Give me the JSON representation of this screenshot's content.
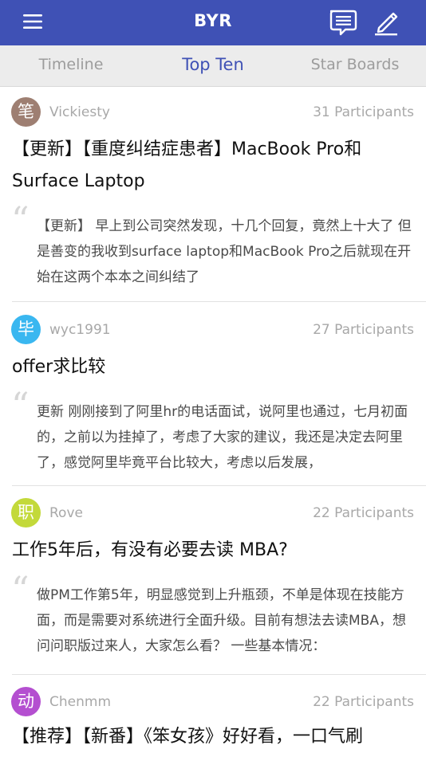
{
  "header": {
    "title": "BYR",
    "menu_icon": "hamburger-menu-icon",
    "messages_icon": "chat-bubble-icon",
    "compose_icon": "pencil-compose-icon",
    "color": "#3f51b5"
  },
  "tabs": [
    {
      "label": "Timeline",
      "active": false
    },
    {
      "label": "Top Ten",
      "active": true
    },
    {
      "label": "Star Boards",
      "active": false
    }
  ],
  "posts": [
    {
      "avatar_char": "笔",
      "avatar_color": "#9e7f72",
      "author": "Vickiesty",
      "participants": "31 Participants",
      "title": "【更新】【重度纠结症患者】MacBook Pro和Surface Laptop",
      "excerpt": "【更新】 早上到公司突然发现，十几个回复，竟然上十大了 但是善变的我收到surface laptop和MacBook Pro之后就现在开始在这两个本本之间纠结了"
    },
    {
      "avatar_char": "毕",
      "avatar_color": "#3ab7f0",
      "author": "wyc1991",
      "participants": "27 Participants",
      "title": "offer求比较",
      "excerpt": "更新 刚刚接到了阿里hr的电话面试，说阿里也通过，七月初面的，之前以为挂掉了，考虑了大家的建议，我还是决定去阿里了，感觉阿里毕竟平台比较大，考虑以后发展，"
    },
    {
      "avatar_char": "职",
      "avatar_color": "#c3d93a",
      "author": "Rove",
      "participants": "22 Participants",
      "title": "工作5年后，有没有必要去读 MBA?",
      "excerpt": "做PM工作第5年，明显感觉到上升瓶颈，不单是体现在技能方面，而是需要对系统进行全面升级。目前有想法去读MBA，想问问职版过来人，大家怎么看？ 一些基本情况："
    },
    {
      "avatar_char": "动",
      "avatar_color": "#b44fd0",
      "author": "Chenmm",
      "participants": "22 Participants",
      "title": "【推荐】【新番】《笨女孩》好好看，一口气刷",
      "excerpt": ""
    }
  ]
}
